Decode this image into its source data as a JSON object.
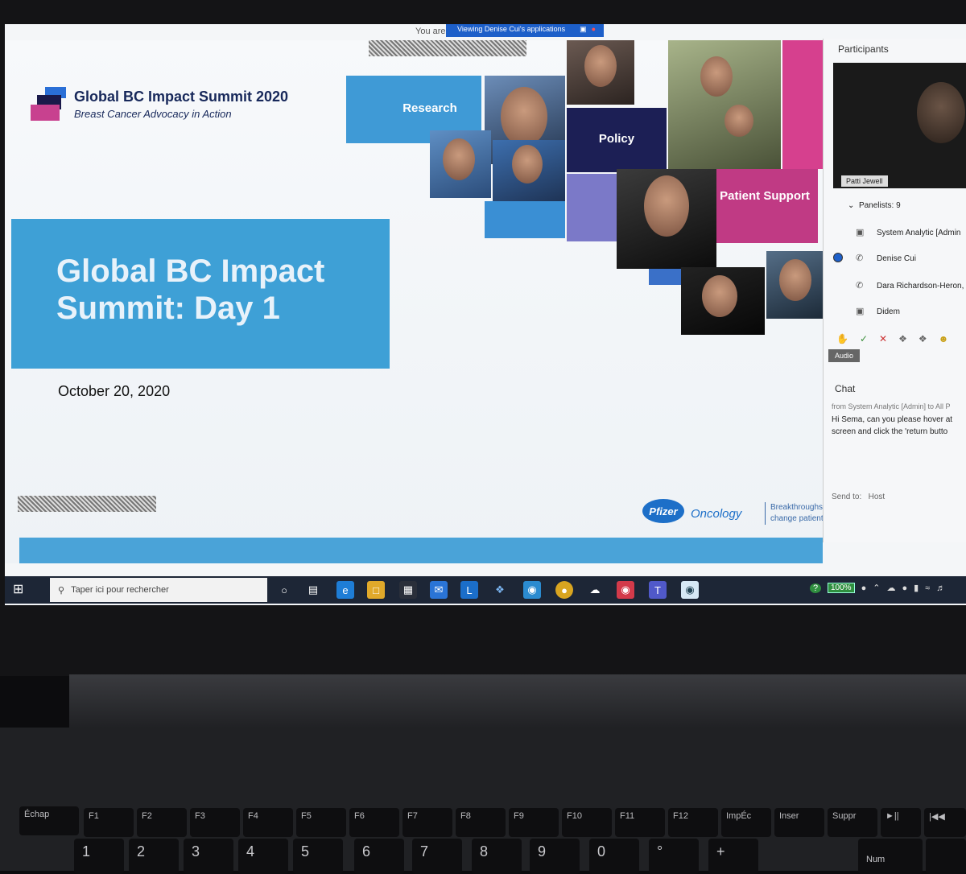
{
  "banner": {
    "prefix": "You are",
    "text": "Viewing Denise Cui's applications"
  },
  "slide": {
    "logo_title": "Global BC Impact Summit 2020",
    "logo_subtitle": "Breast Cancer Advocacy in Action",
    "title": "Global BC Impact Summit: Day 1",
    "date": "October 20, 2020",
    "tiles": {
      "research": "Research",
      "policy": "Policy",
      "patient_support": "Patient Support"
    },
    "sponsor_logo": "Pfizer",
    "sponsor_name": "Oncology",
    "tagline": "Breakthroughs change patient"
  },
  "participants": {
    "title": "Participants",
    "video_name": "Patti Jewell",
    "panelists_label": "Panelists: 9",
    "panelists": [
      "System Analytic [Admin",
      "Denise Cui",
      "Dara Richardson-Heron,",
      "Didem"
    ],
    "audio_tooltip": "Audio"
  },
  "chat": {
    "title": "Chat",
    "from": "from System Analytic [Admin] to All P",
    "message": "Hi Sema, can you please hover at screen and click the 'return butto",
    "send_to_label": "Send to:",
    "send_to_value": "Host"
  },
  "taskbar": {
    "search_placeholder": "Taper ici pour rechercher",
    "battery": "100%"
  },
  "keyboard": {
    "fn_row": [
      "Échap",
      "F1",
      "F2",
      "F3",
      "F4",
      "F5",
      "F6",
      "F7",
      "F8",
      "F9",
      "F10",
      "F11",
      "F12",
      "ImpÉc",
      "Inser",
      "Suppr"
    ],
    "num_row": [
      "1",
      "2",
      "3",
      "4",
      "5",
      "6",
      "7",
      "8",
      "9",
      "0",
      "°",
      "+"
    ],
    "num_label": "Num"
  },
  "colors": {
    "accent": "#3ea0d6",
    "brand_navy": "#17285a",
    "brand_pink": "#c8418f",
    "taskbar": "#1d2636"
  }
}
